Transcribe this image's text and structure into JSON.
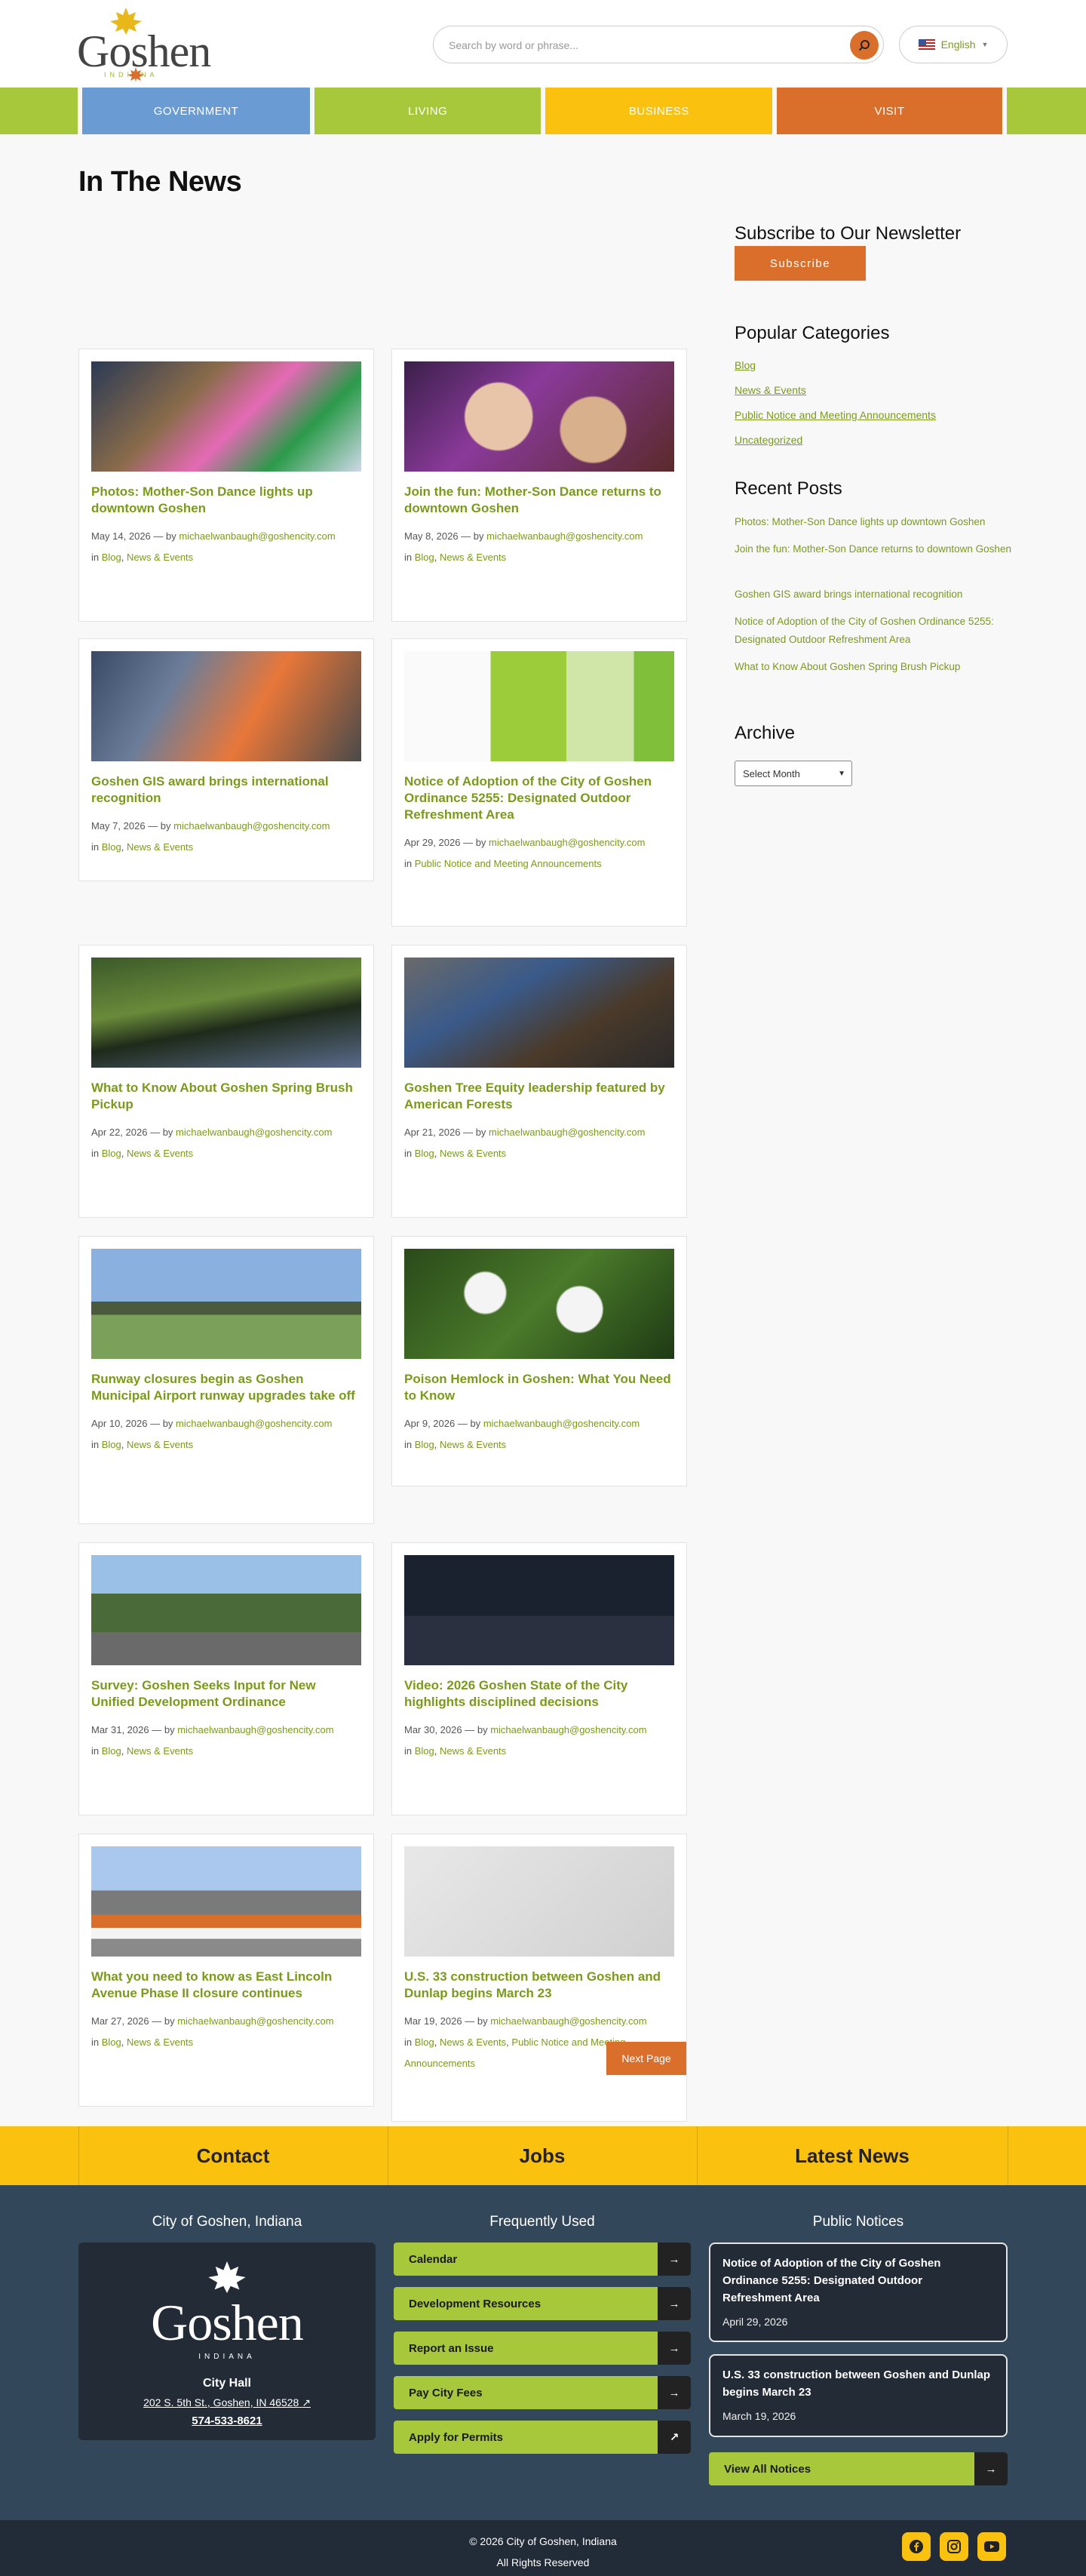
{
  "header": {
    "logo_text": "Goshen",
    "logo_sub": "INDIANA",
    "search_placeholder": "Search by word or phrase...",
    "language": "English"
  },
  "nav": {
    "items": [
      {
        "label": "Government",
        "color": "#6b9bd3"
      },
      {
        "label": "Living",
        "color": "#a6c83a"
      },
      {
        "label": "Business",
        "color": "#fbc10f"
      },
      {
        "label": "Visit",
        "color": "#d96f2a"
      }
    ]
  },
  "main": {
    "title": "In The News",
    "by_label": "— by",
    "in_label": "in",
    "posts": [
      {
        "title": "Photos: Mother-Son Dance lights up downtown Goshen",
        "date": "May 14, 2026",
        "author": "michaelwanbaugh@goshencity.com",
        "cats": [
          "Blog",
          "News & Events"
        ]
      },
      {
        "title": "Join the fun: Mother-Son Dance returns to downtown Goshen",
        "date": "May 8, 2026",
        "author": "michaelwanbaugh@goshencity.com",
        "cats": [
          "Blog",
          "News & Events"
        ]
      },
      {
        "title": "Goshen GIS award brings international recognition",
        "date": "May 7, 2026",
        "author": "michaelwanbaugh@goshencity.com",
        "cats": [
          "Blog",
          "News & Events"
        ]
      },
      {
        "title": "Notice of Adoption of the City of Goshen Ordinance 5255: Designated Outdoor Refreshment Area",
        "date": "Apr 29, 2026",
        "author": "michaelwanbaugh@goshencity.com",
        "cats": [
          "Public Notice and Meeting Announcements"
        ]
      },
      {
        "title": "What to Know About Goshen Spring Brush Pickup",
        "date": "Apr 22, 2026",
        "author": "michaelwanbaugh@goshencity.com",
        "cats": [
          "Blog",
          "News & Events"
        ]
      },
      {
        "title": "Goshen Tree Equity leadership featured by American Forests",
        "date": "Apr 21, 2026",
        "author": "michaelwanbaugh@goshencity.com",
        "cats": [
          "Blog",
          "News & Events"
        ]
      },
      {
        "title": "Runway closures begin as Goshen Municipal Airport runway upgrades take off",
        "date": "Apr 10, 2026",
        "author": "michaelwanbaugh@goshencity.com",
        "cats": [
          "Blog",
          "News & Events"
        ]
      },
      {
        "title": "Poison Hemlock in Goshen: What You Need to Know",
        "date": "Apr 9, 2026",
        "author": "michaelwanbaugh@goshencity.com",
        "cats": [
          "Blog",
          "News & Events"
        ]
      },
      {
        "title": "Survey: Goshen Seeks Input for New Unified Development Ordinance",
        "date": "Mar 31, 2026",
        "author": "michaelwanbaugh@goshencity.com",
        "cats": [
          "Blog",
          "News & Events"
        ]
      },
      {
        "title": "Video: 2026 Goshen State of the City highlights disciplined decisions",
        "date": "Mar 30, 2026",
        "author": "michaelwanbaugh@goshencity.com",
        "cats": [
          "Blog",
          "News & Events"
        ]
      },
      {
        "title": "What you need to know as East Lincoln Avenue Phase II closure continues",
        "date": "Mar 27, 2026",
        "author": "michaelwanbaugh@goshencity.com",
        "cats": [
          "Blog",
          "News & Events"
        ]
      },
      {
        "title": "U.S. 33 construction between Goshen and Dunlap begins March 23",
        "date": "Mar 19, 2026",
        "author": "michaelwanbaugh@goshencity.com",
        "cats": [
          "Blog",
          "News & Events",
          "Public Notice and Meeting Announcements"
        ]
      }
    ],
    "next_page": "Next Page"
  },
  "sidebar": {
    "newsletter_heading": "Subscribe to Our Newsletter",
    "subscribe_label": "Subscribe",
    "categories_heading": "Popular Categories",
    "categories": [
      "Blog",
      "News & Events",
      "Public Notice and Meeting Announcements",
      "Uncategorized"
    ],
    "recent_heading": "Recent Posts",
    "recent": [
      "Photos: Mother-Son Dance lights up downtown Goshen",
      "Join the fun: Mother-Son Dance returns to downtown Goshen",
      "Goshen GIS award brings international recognition",
      "Notice of Adoption of the City of Goshen Ordinance 5255: Designated Outdoor Refreshment Area",
      "What to Know About Goshen Spring Brush Pickup"
    ],
    "archive_heading": "Archive",
    "archive_select": "Select Month"
  },
  "band": {
    "items": [
      "Contact",
      "Jobs",
      "Latest News"
    ]
  },
  "footer": {
    "col1_heading": "City of Goshen, Indiana",
    "col2_heading": "Frequently Used",
    "col3_heading": "Public Notices",
    "logo_text": "Goshen",
    "logo_sub": "INDIANA",
    "hall_name": "City Hall",
    "hall_address": "202 S. 5th St., Goshen, IN 46528",
    "hall_phone": "574-533-8621",
    "quick_links": [
      "Calendar",
      "Development Resources",
      "Report an Issue",
      "Pay City Fees",
      "Apply for Permits"
    ],
    "notices": [
      {
        "title": "Notice of Adoption of the City of Goshen Ordinance 5255: Designated Outdoor Refreshment Area",
        "date": "April 29, 2026"
      },
      {
        "title": "U.S. 33 construction between Goshen and Dunlap begins March 23",
        "date": "March 19, 2026"
      }
    ],
    "view_all": "View All Notices",
    "copyright": "© 2026 City of Goshen, Indiana",
    "rights": "All Rights Reserved"
  }
}
